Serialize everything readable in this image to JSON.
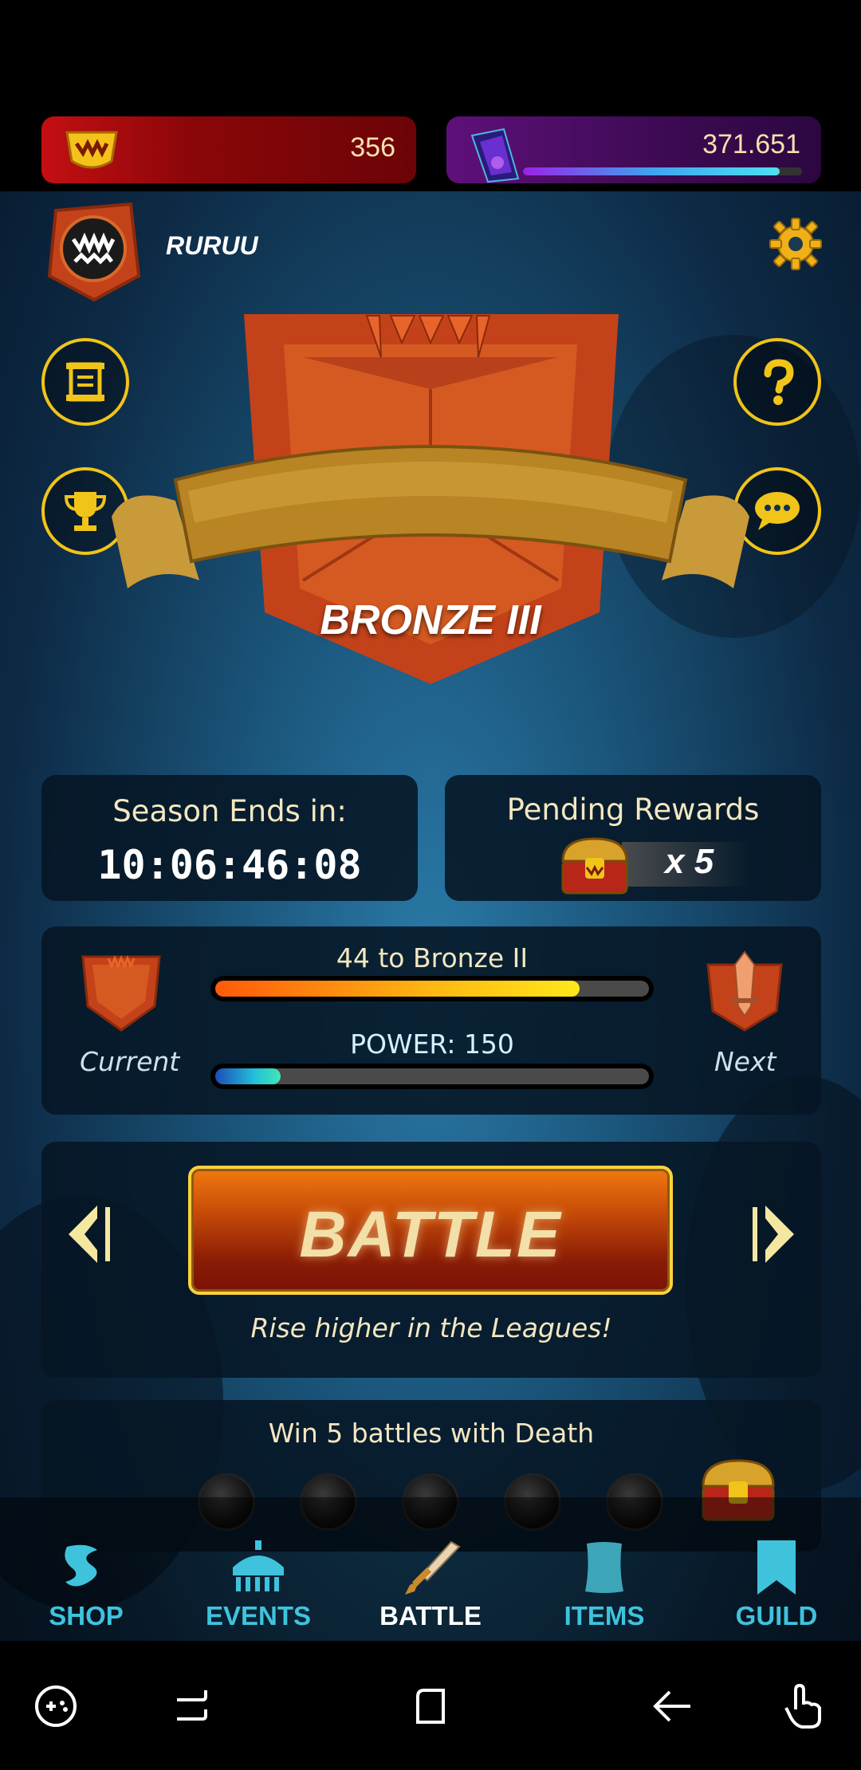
{
  "resources": {
    "crowns": "356",
    "crystals": "371.651",
    "crystal_bar_fraction": 0.92
  },
  "player": {
    "name": "RURUU"
  },
  "league": {
    "name": "BRONZE III"
  },
  "season": {
    "label": "Season Ends in:",
    "time": "10:06:46:08"
  },
  "rewards": {
    "label": "Pending Rewards",
    "count": "x 5"
  },
  "progress": {
    "current_label": "Current",
    "next_label": "Next",
    "rank_text": "44 to Bronze II",
    "rank_fraction": 0.84,
    "power_text": "POWER: 150",
    "power_fraction": 0.15
  },
  "battle": {
    "button_label": "BATTLE",
    "subtitle": "Rise higher in the Leagues!"
  },
  "quest": {
    "label": "Win 5 battles with Death",
    "slots_total": 5
  },
  "nav": {
    "items": [
      {
        "label": "SHOP",
        "icon": "shop-icon"
      },
      {
        "label": "EVENTS",
        "icon": "events-icon"
      },
      {
        "label": "BATTLE",
        "icon": "sword-icon",
        "active": true
      },
      {
        "label": "ITEMS",
        "icon": "scroll-icon"
      },
      {
        "label": "GUILD",
        "icon": "bookmark-icon"
      }
    ]
  },
  "colors": {
    "accent": "#f0c418",
    "nav": "#3fc3dd",
    "bronze": "#c4421a"
  }
}
